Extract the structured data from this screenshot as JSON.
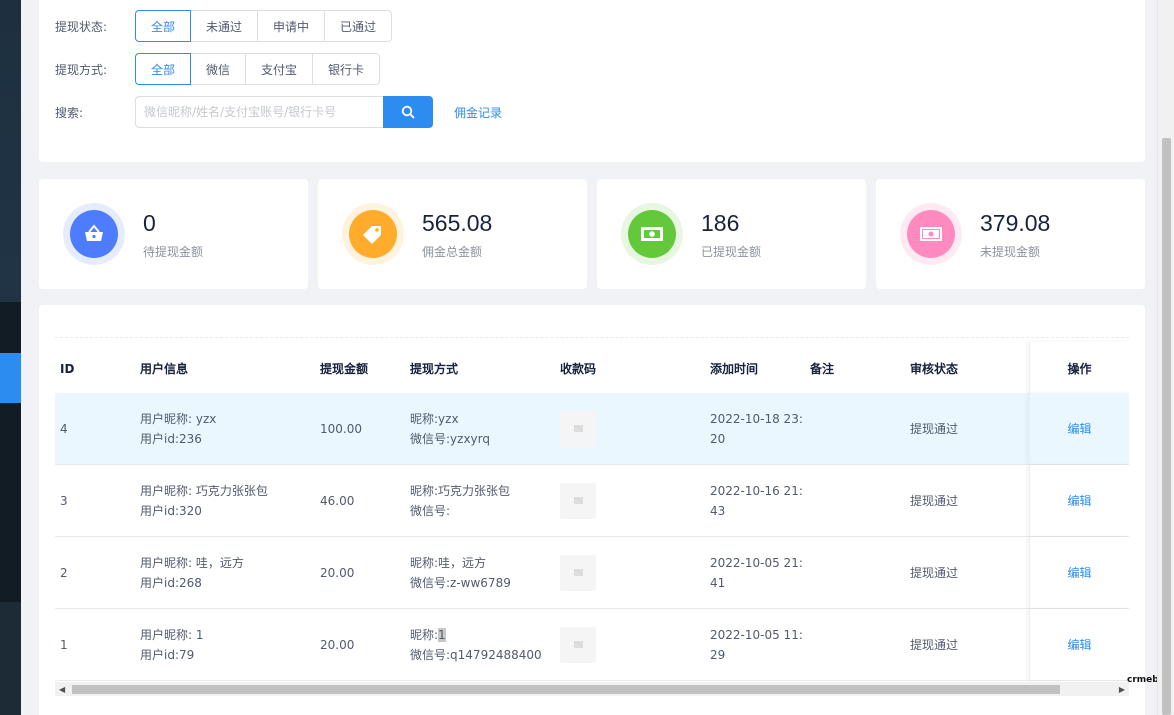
{
  "filters": {
    "status_label": "提现状态:",
    "status_options": [
      "全部",
      "未通过",
      "申请中",
      "已通过"
    ],
    "method_label": "提现方式:",
    "method_options": [
      "全部",
      "微信",
      "支付宝",
      "银行卡"
    ],
    "search_label": "搜索:",
    "search_placeholder": "微信昵称/姓名/支付宝账号/银行卡号",
    "commission_link": "佣金记录"
  },
  "stats": [
    {
      "value": "0",
      "label": "待提现金额",
      "icon": "basket-icon",
      "color": "#4d7cfe",
      "ring": "#e5ecfe"
    },
    {
      "value": "565.08",
      "label": "佣金总金额",
      "icon": "tag-icon",
      "color": "#ffab2b",
      "ring": "#fff3e0"
    },
    {
      "value": "186",
      "label": "已提现金额",
      "icon": "cash-icon",
      "color": "#64c93a",
      "ring": "#e8f7e1"
    },
    {
      "value": "379.08",
      "label": "未提现金额",
      "icon": "banknote-icon",
      "color": "#ff8ac0",
      "ring": "#ffeaf4"
    }
  ],
  "table": {
    "headers": {
      "id": "ID",
      "user": "用户信息",
      "amount": "提现金额",
      "method": "提现方式",
      "qr": "收款码",
      "time": "添加时间",
      "note": "备注",
      "status": "审核状态",
      "action": "操作"
    },
    "rows": [
      {
        "id": "4",
        "nickname": "用户昵称: yzx",
        "uid": "用户id:236",
        "amount": "100.00",
        "method_name_prefix": "昵称:",
        "method_name": "yzx",
        "method_account": "微信号:yzxyrq",
        "time": "2022-10-18 23:20",
        "note": "",
        "status": "提现通过",
        "action": "编辑"
      },
      {
        "id": "3",
        "nickname": "用户昵称: 巧克力张张包",
        "uid": "用户id:320",
        "amount": "46.00",
        "method_name_prefix": "昵称:",
        "method_name": "巧克力张张包",
        "method_account": "微信号:",
        "time": "2022-10-16 21:43",
        "note": "",
        "status": "提现通过",
        "action": "编辑"
      },
      {
        "id": "2",
        "nickname": "用户昵称: 哇，远方",
        "uid": "用户id:268",
        "amount": "20.00",
        "method_name_prefix": "昵称:",
        "method_name": "哇，远方",
        "method_account": "微信号:z-ww6789",
        "time": "2022-10-05 21:41",
        "note": "",
        "status": "提现通过",
        "action": "编辑"
      },
      {
        "id": "1",
        "nickname": "用户昵称: 1",
        "uid": "用户id:79",
        "amount": "20.00",
        "method_name_prefix": "昵称:",
        "method_name": "1",
        "method_account": "微信号:q14792488400",
        "time": "2022-10-05 11:29",
        "note": "",
        "status": "提现通过",
        "action": "编辑"
      }
    ]
  },
  "watermark": "crmeb"
}
